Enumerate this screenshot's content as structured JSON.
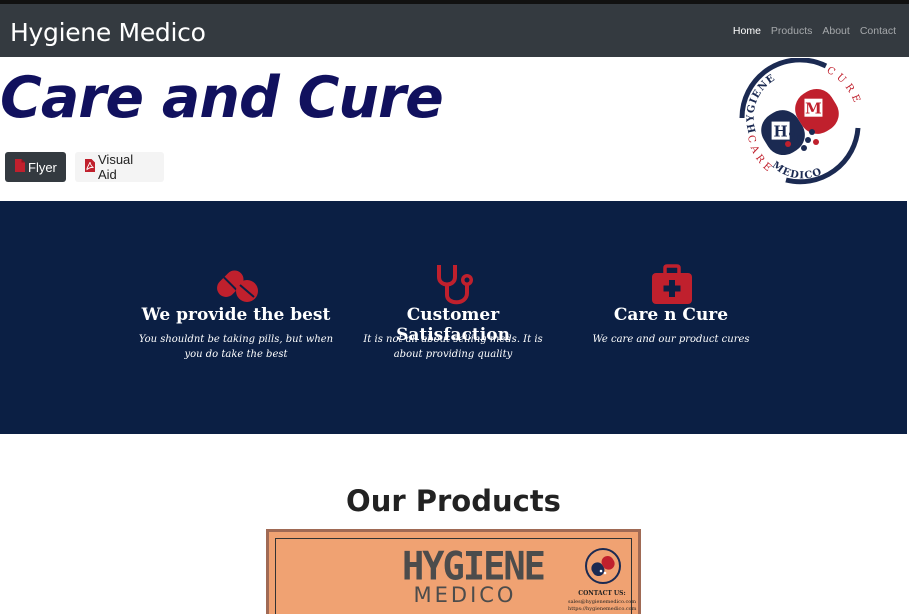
{
  "header": {
    "brand": "Hygiene Medico",
    "nav": [
      {
        "label": "Home",
        "active": true
      },
      {
        "label": "Products",
        "active": false
      },
      {
        "label": "About",
        "active": false
      },
      {
        "label": "Contact",
        "active": false
      }
    ]
  },
  "hero": {
    "title": "Care and Cure",
    "buttons": [
      {
        "label": "Flyer",
        "icon": "file-pdf-icon"
      },
      {
        "label": "Visual Aid",
        "icon": "file-pdf-icon"
      }
    ],
    "logo": {
      "initials": [
        "H",
        "M"
      ],
      "arc_text_left": "HYGIENE",
      "arc_text_bottom": "MEDICO",
      "side_text_1": "CARE",
      "side_text_2": "CURE"
    }
  },
  "features": [
    {
      "icon": "pills-icon",
      "title": "We provide the best",
      "text": "You shouldnt be taking pills, but when you do take the best"
    },
    {
      "icon": "stethoscope-icon",
      "title": "Customer Satisfaction",
      "text": "It is not all about selling meds. It is about providing quality"
    },
    {
      "icon": "medkit-icon",
      "title": "Care n Cure",
      "text": "We care and our product cures"
    }
  ],
  "products": {
    "title": "Our Products",
    "card": {
      "brand": "HYGIENE",
      "sub": "MEDICO",
      "contact_title": "CONTACT US:",
      "contact_email": "sales@hygienemedico.com",
      "contact_web": "https://hygienemedico.com"
    }
  },
  "colors": {
    "navbar": "#343a40",
    "hero_title": "#11115e",
    "features_bg": "#0b1f44",
    "icon_red": "#c0202d",
    "product_card": "#f0a272"
  }
}
